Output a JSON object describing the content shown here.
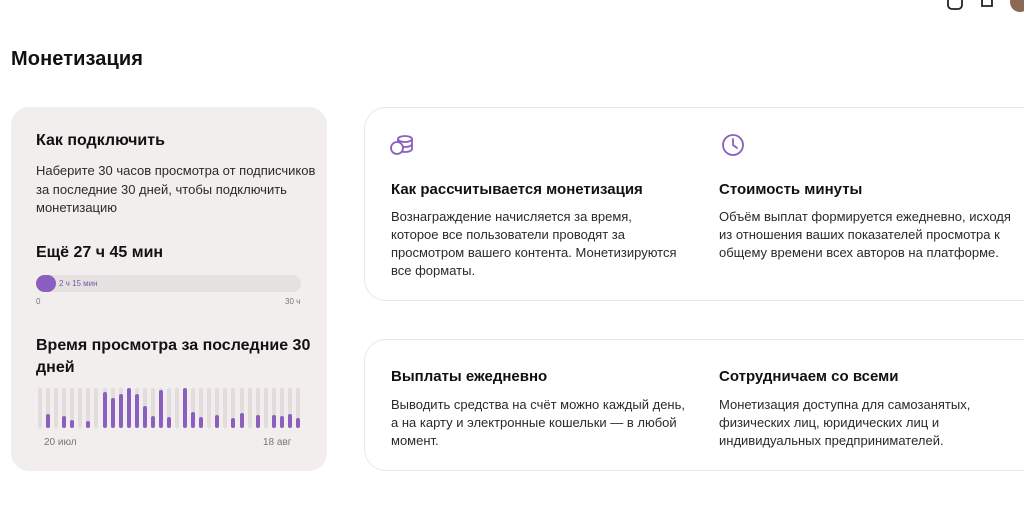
{
  "page": {
    "title": "Монетизация"
  },
  "how_to": {
    "title": "Как подключить",
    "description": "Наберите 30 часов просмотра от подписчиков за последние 30 дней, чтобы подключить монетизацию",
    "remaining": "Ещё 27 ч 45 мин",
    "progress": {
      "value_label": "2 ч 15 мин",
      "min_label": "0",
      "max_label": "30 ч",
      "fraction": 0.075
    },
    "watch_time_title": "Время просмотра за последние 30 дней",
    "bars": [
      0,
      0.35,
      0,
      0.3,
      0.2,
      0,
      0.18,
      0,
      0.9,
      0.75,
      0.85,
      1.0,
      0.85,
      0.55,
      0.3,
      0.95,
      0.28,
      0,
      1.0,
      0.4,
      0.28,
      0,
      0.32,
      0,
      0.25,
      0.38,
      0,
      0.32,
      0,
      0.33,
      0.3,
      0.35,
      0.25
    ],
    "axis_start": "20 июл",
    "axis_end": "18 авг",
    "accent": "#8b5fbf"
  },
  "features": {
    "calc": {
      "icon": "coins-icon",
      "title": "Как рассчитывается монетизация",
      "text": "Вознаграждение начисляется за время, которое все пользователи проводят за просмотром вашего контента. Монетизируются все форматы."
    },
    "minute_cost": {
      "icon": "clock-icon",
      "title": "Стоимость минуты",
      "text": "Объём выплат формируется ежедневно, исходя из отношения ваших показателей просмотра к общему времени всех авторов на платформе."
    },
    "daily": {
      "title": "Выплаты ежедневно",
      "text": "Выводить средства на счёт можно каждый день, а на карту и электронные кошельки — в любой момент."
    },
    "everyone": {
      "title": "Сотрудничаем со всеми",
      "text": "Монетизация доступна для самозанятых, физических лиц, юридических лиц и индивидуальных предпринимателей."
    }
  }
}
